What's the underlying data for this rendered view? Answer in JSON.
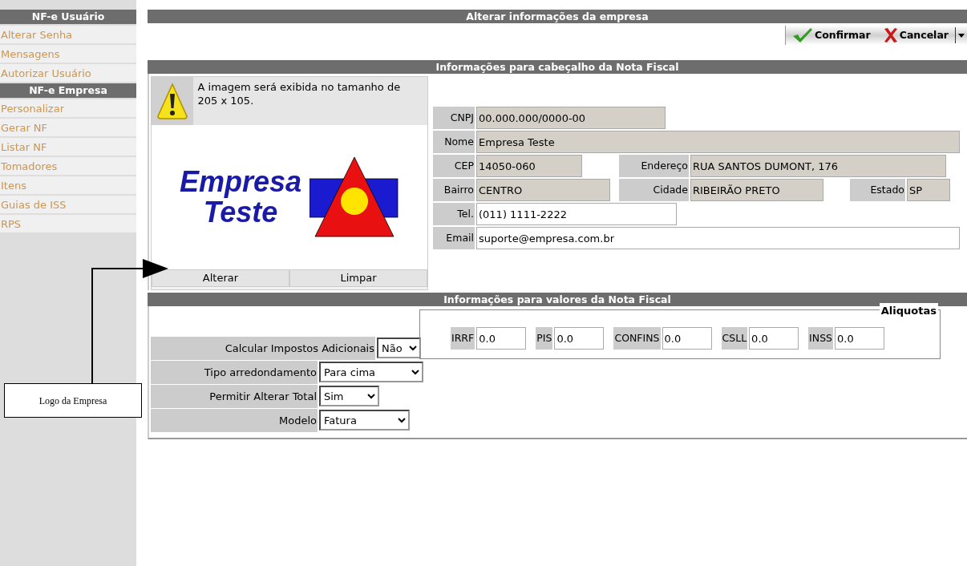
{
  "sidebar": {
    "sections": [
      {
        "title": "NF-e Usuário",
        "items": [
          {
            "label": "Alterar Senha"
          },
          {
            "label": "Mensagens"
          },
          {
            "label": "Autorizar Usuário"
          }
        ]
      },
      {
        "title": "NF-e Empresa",
        "items": [
          {
            "label": "Personalizar"
          },
          {
            "label": "Gerar NF"
          },
          {
            "label": "Listar NF"
          },
          {
            "label": "Tomadores"
          },
          {
            "label": "Itens"
          },
          {
            "label": "Guias de ISS"
          },
          {
            "label": "RPS"
          }
        ]
      }
    ]
  },
  "page_title": "Alterar informações da empresa",
  "toolbar": {
    "buttons": [
      {
        "label": "Confirmar",
        "kind": "confirm"
      },
      {
        "label": "Cancelar",
        "kind": "cancel"
      }
    ]
  },
  "header_section": {
    "title": "Informações para cabeçalho da Nota Fiscal",
    "logo_panel": {
      "warning": "A imagem será exibida no tamanho de 205 x 105.",
      "logo_lines": [
        "Empresa",
        "Teste"
      ],
      "buttons": [
        "Alterar",
        "Limpar"
      ]
    },
    "rows": [
      [
        {
          "label": "CNPJ",
          "value": "00.000.000/0000-00",
          "disabled": true
        }
      ],
      [
        {
          "label": "Nome",
          "value": "Empresa Teste",
          "disabled": true
        }
      ],
      [
        {
          "label": "CEP",
          "value": "14050-060",
          "disabled": true
        },
        {
          "label": "Endereço",
          "value": "RUA SANTOS DUMONT, 176",
          "disabled": true
        }
      ],
      [
        {
          "label": "Bairro",
          "value": "CENTRO",
          "disabled": true
        },
        {
          "label": "Cidade",
          "value": "RIBEIRÃO PRETO",
          "disabled": true
        },
        {
          "label": "Estado",
          "value": "SP",
          "disabled": true
        }
      ],
      [
        {
          "label": "Tel.",
          "value": "(011) 1111-2222",
          "disabled": false
        }
      ],
      [
        {
          "label": "Email",
          "value": "suporte@empresa.com.br",
          "disabled": false
        }
      ]
    ]
  },
  "values_section": {
    "title": "Informações para valores da Nota Fiscal",
    "selects": [
      {
        "label": "Calcular Impostos Adicionais",
        "value": "Não"
      },
      {
        "label": "Tipo arredondamento",
        "value": "Para cima"
      },
      {
        "label": "Permitir Alterar Total",
        "value": "Sim"
      },
      {
        "label": "Modelo",
        "value": "Fatura"
      }
    ],
    "aliquotas": {
      "legend": "Aliquotas",
      "fields": [
        {
          "label": "IRRF",
          "value": "0.0"
        },
        {
          "label": "PIS",
          "value": "0.0"
        },
        {
          "label": "CONFINS",
          "value": "0.0"
        },
        {
          "label": "CSLL",
          "value": "0.0"
        },
        {
          "label": "INSS",
          "value": "0.0"
        }
      ]
    }
  },
  "annotation": {
    "text": "Logo da Empresa"
  }
}
